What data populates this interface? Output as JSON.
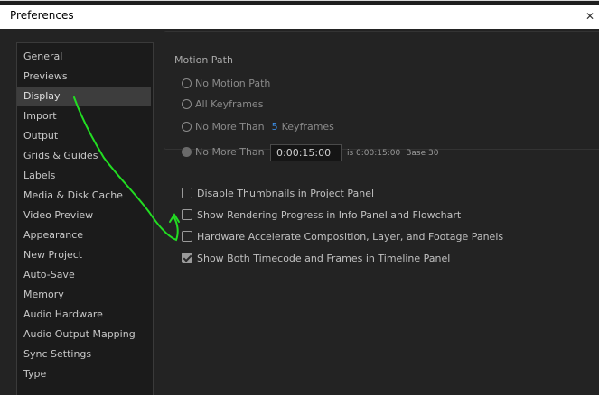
{
  "window": {
    "title": "Preferences"
  },
  "sidebar": {
    "items": [
      {
        "label": "General",
        "selected": false
      },
      {
        "label": "Previews",
        "selected": false
      },
      {
        "label": "Display",
        "selected": true
      },
      {
        "label": "Import",
        "selected": false
      },
      {
        "label": "Output",
        "selected": false
      },
      {
        "label": "Grids & Guides",
        "selected": false
      },
      {
        "label": "Labels",
        "selected": false
      },
      {
        "label": "Media & Disk Cache",
        "selected": false
      },
      {
        "label": "Video Preview",
        "selected": false
      },
      {
        "label": "Appearance",
        "selected": false
      },
      {
        "label": "New Project",
        "selected": false
      },
      {
        "label": "Auto-Save",
        "selected": false
      },
      {
        "label": "Memory",
        "selected": false
      },
      {
        "label": "Audio Hardware",
        "selected": false
      },
      {
        "label": "Audio Output Mapping",
        "selected": false
      },
      {
        "label": "Sync Settings",
        "selected": false
      },
      {
        "label": "Type",
        "selected": false
      }
    ]
  },
  "motion_path": {
    "legend": "Motion Path",
    "options": {
      "no_motion_path": "No Motion Path",
      "all_keyframes": "All Keyframes",
      "no_more_than": "No More Than",
      "keyframes_count": "5",
      "keyframes_label": "Keyframes",
      "no_more_than_time": "No More Than"
    },
    "selected": "no_more_than_time",
    "timecode_value": "0:00:15:00",
    "timecode_info": "is 0:00:15:00",
    "timecode_base": "Base 30"
  },
  "checkboxes": [
    {
      "label": "Disable Thumbnails in Project Panel",
      "checked": false
    },
    {
      "label": "Show Rendering Progress in Info Panel and Flowchart",
      "checked": false
    },
    {
      "label": "Hardware Accelerate Composition, Layer, and Footage Panels",
      "checked": false
    },
    {
      "label": "Show Both Timecode and Frames in Timeline Panel",
      "checked": true
    }
  ],
  "colors": {
    "accent": "#3c8ee6",
    "annotation": "#22dd22",
    "selected_bg": "#3d3d3d"
  }
}
